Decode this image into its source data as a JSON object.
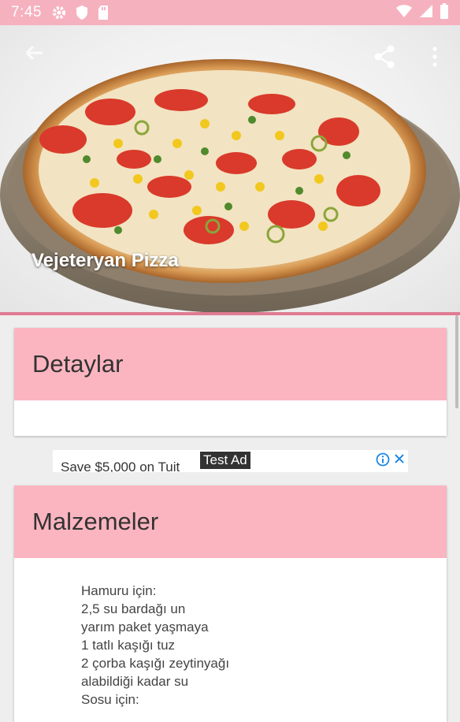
{
  "status_bar": {
    "time": "7:45",
    "icons": [
      "gear-icon",
      "shield-icon",
      "sd-card-icon",
      "wifi-icon",
      "signal-icon",
      "battery-icon"
    ]
  },
  "hero": {
    "title": "Vejeteryan Pizza",
    "image": "pizza-photo"
  },
  "toolbar": {
    "back_icon": "back-arrow-icon",
    "share_icon": "share-icon",
    "more_icon": "more-vert-icon"
  },
  "details": {
    "title": "Detaylar"
  },
  "ad": {
    "text": "Save $5,000 on Tuit",
    "label": "Test Ad"
  },
  "ingredients": {
    "title": "Malzemeler",
    "lines": [
      "Hamuru için:",
      "2,5 su bardağı un",
      "yarım paket yaşmaya",
      "1 tatlı kaşığı tuz",
      "2 çorba kaşığı zeytinyağı",
      "alabildiği kadar su",
      "Sosu için:"
    ]
  },
  "colors": {
    "status_bar": "#f6b1bf",
    "card_header": "#fbb5c0",
    "accent_line": "#e07a92"
  }
}
